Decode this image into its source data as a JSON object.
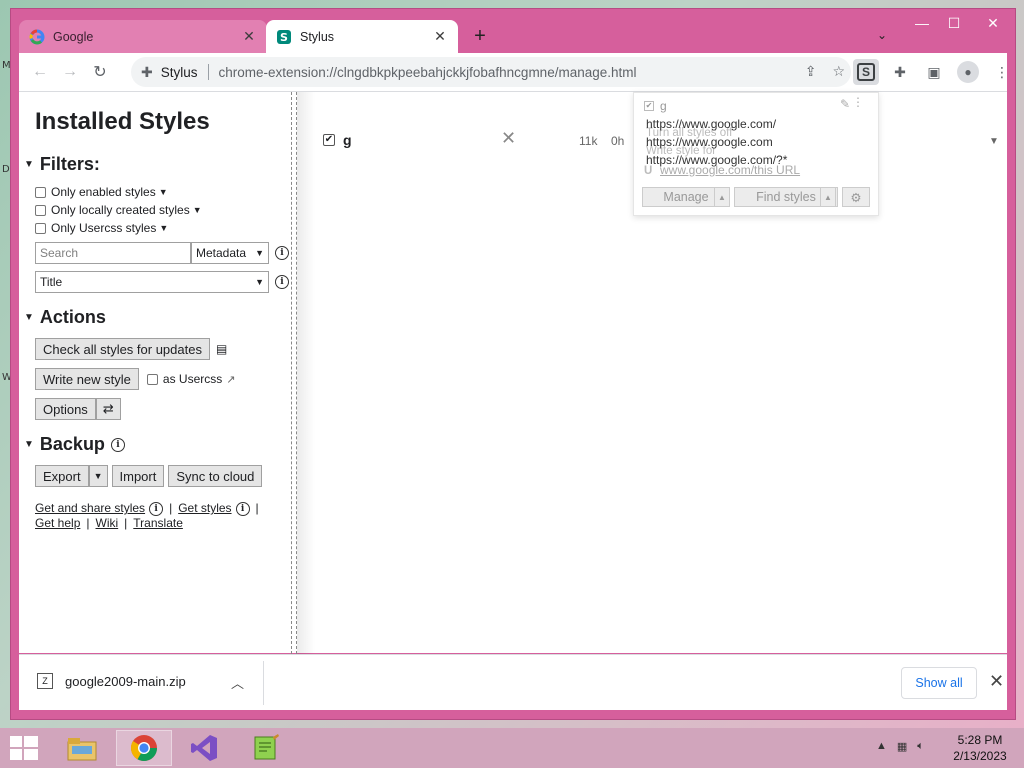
{
  "tabs": [
    {
      "title": "Google",
      "favicon": "google-favicon",
      "active": false
    },
    {
      "title": "Stylus",
      "favicon": "stylus-favicon",
      "active": true
    }
  ],
  "toolbar": {
    "extension_name": "Stylus",
    "url": "chrome-extension://clngdbkpkpeebahjckkjfobafhncgmne/manage.html"
  },
  "sidebar": {
    "title": "Installed Styles",
    "filters_heading": "Filters:",
    "filters": [
      "Only enabled styles",
      "Only locally created styles",
      "Only Usercss styles"
    ],
    "search_placeholder": "Search",
    "search_mode": "Metadata",
    "sort_by": "Title",
    "actions_heading": "Actions",
    "check_updates_label": "Check all styles for updates",
    "write_new_label": "Write new style",
    "as_usercss_label": "as Usercss",
    "options_label": "Options",
    "backup_heading": "Backup",
    "export_label": "Export",
    "import_label": "Import",
    "sync_label": "Sync to cloud",
    "links": {
      "get_share": "Get and share styles",
      "get_styles": "Get styles",
      "get_help": "Get help",
      "wiki": "Wiki",
      "translate": "Translate"
    }
  },
  "style_entry": {
    "name": "g",
    "enabled": true,
    "size": "11k",
    "age": "0h"
  },
  "popup": {
    "style_name": "g",
    "turn_off_label": "Turn all styles off",
    "write_for_label": "Write style for",
    "urls": [
      "https://www.google.com/",
      "https://www.google.com",
      "https://www.google.com/?*"
    ],
    "this_url": "www.google.com/this URL",
    "prefix": "U",
    "manage_label": "Manage",
    "find_styles_label": "Find styles"
  },
  "downloads": {
    "file_name": "google2009-main.zip",
    "show_all_label": "Show all"
  },
  "taskbar": {
    "time": "5:28 PM",
    "date": "2/13/2023",
    "apps": [
      "file-explorer-icon",
      "chrome-icon",
      "visual-studio-icon",
      "notepad-plus-icon"
    ]
  },
  "colors": {
    "window_frame": "#d65f9c",
    "tab_inactive": "#e280b2",
    "link_blue": "#1a73e8"
  }
}
